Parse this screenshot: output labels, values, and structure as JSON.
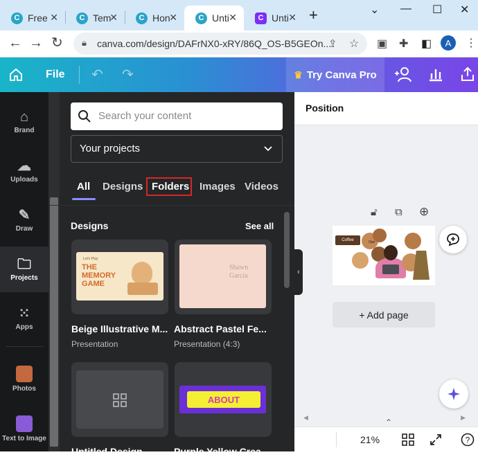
{
  "browser": {
    "tabs": [
      {
        "label": "Free",
        "favicon": "C"
      },
      {
        "label": "Tem",
        "favicon": "C"
      },
      {
        "label": "Hon",
        "favicon": "C"
      },
      {
        "label": "Unti",
        "favicon": "C"
      },
      {
        "label": "Unti",
        "favicon": "C"
      }
    ],
    "url": "canva.com/design/DAFrNX0-xRY/86Q_OS-B5GEOn...",
    "profile_initial": "A"
  },
  "header": {
    "file_label": "File",
    "try_pro_label": "Try Canva Pro"
  },
  "rail": {
    "items": [
      {
        "label": "Brand",
        "icon": "brand-icon"
      },
      {
        "label": "Uploads",
        "icon": "upload-icon"
      },
      {
        "label": "Draw",
        "icon": "draw-icon"
      },
      {
        "label": "Projects",
        "icon": "folder-icon"
      },
      {
        "label": "Apps",
        "icon": "apps-grid-icon"
      },
      {
        "label": "Photos",
        "icon": "photos-icon"
      },
      {
        "label": "Text to Image",
        "icon": "text-to-image-icon"
      }
    ]
  },
  "panel": {
    "search_placeholder": "Search your content",
    "dropdown_value": "Your projects",
    "tabs": [
      "All",
      "Designs",
      "Folders",
      "Images",
      "Videos"
    ],
    "section_title": "Designs",
    "see_all": "See all",
    "cards": [
      {
        "title": "Beige Illustrative M...",
        "subtitle": "Presentation",
        "thumb_top": "Let's Play",
        "thumb_title": "THE MEMORY GAME"
      },
      {
        "title": "Abstract Pastel Fe...",
        "subtitle": "Presentation (4:3)",
        "thumb_title": "Shawn Garcia"
      },
      {
        "title": "Untitled Design",
        "subtitle": ""
      },
      {
        "title": "Purple Yellow Crea...",
        "subtitle": "",
        "thumb_title": "ABOUT"
      }
    ]
  },
  "editor": {
    "position_label": "Position",
    "add_page_label": "+ Add page",
    "zoom_label": "21%",
    "page_badge_left": "Coffee",
    "page_badge_right": "Ope"
  },
  "colors": {
    "header_start": "#19b5c8",
    "header_end": "#7a45e8",
    "panel_bg": "#252627",
    "rail_bg": "#18191b",
    "highlight_red": "#d62828",
    "tab_underline": "#8b8eff"
  }
}
